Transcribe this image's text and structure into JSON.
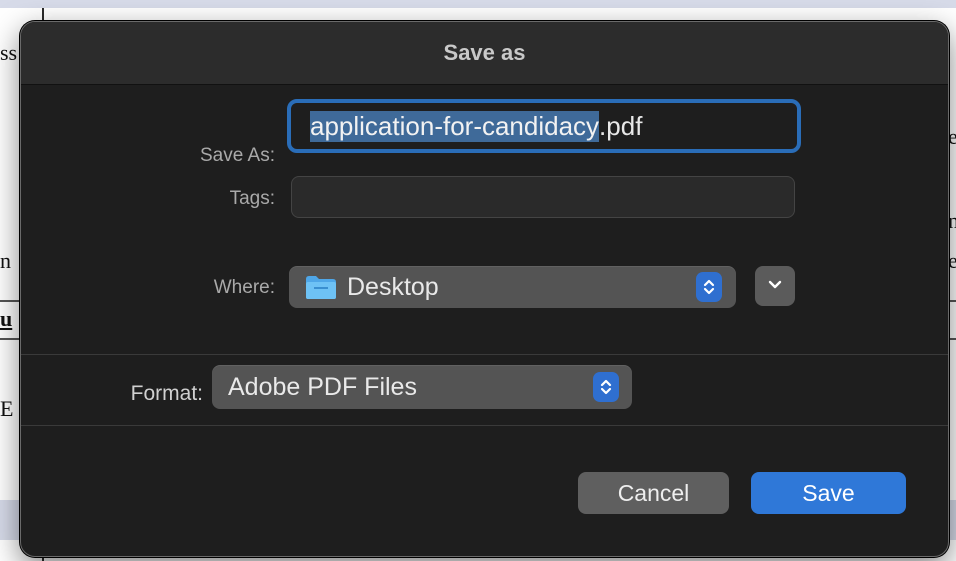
{
  "dialog": {
    "title": "Save as",
    "save_as_label": "Save As:",
    "filename_selected": "application-for-candidacy",
    "filename_extension": ".pdf",
    "tags_label": "Tags:",
    "tags_value": "",
    "where_label": "Where:",
    "where_value": "Desktop",
    "format_label": "Format:",
    "format_value": "Adobe PDF Files",
    "cancel_label": "Cancel",
    "save_label": "Save"
  },
  "background": {
    "fragments": [
      "ss",
      "n",
      "u",
      "E",
      "e",
      "n",
      "e"
    ]
  },
  "colors": {
    "accent": "#2f78d8",
    "selection": "#3f6a99",
    "focus_ring": "#2a6db8"
  },
  "icons": {
    "folder": "folder-icon",
    "stepper": "chevron-up-down-icon",
    "disclosure": "chevron-down-icon"
  }
}
